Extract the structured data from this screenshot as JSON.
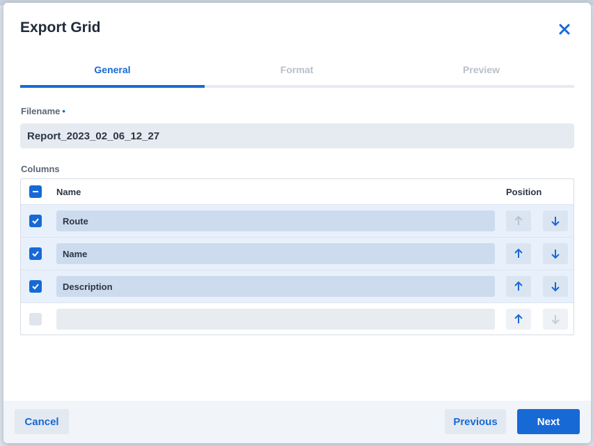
{
  "dialog": {
    "title": "Export Grid",
    "close_icon": "close-icon",
    "accent_color": "#1769d6"
  },
  "tabs": [
    {
      "label": "General",
      "active": true
    },
    {
      "label": "Format",
      "active": false
    },
    {
      "label": "Preview",
      "active": false
    }
  ],
  "filename": {
    "label": "Filename",
    "required_marker": "•",
    "value": "Report_2023_02_06_12_27"
  },
  "columns": {
    "label": "Columns",
    "header": {
      "name": "Name",
      "position": "Position",
      "select_all_state": "indeterminate"
    },
    "rows": [
      {
        "name": "Route",
        "checked": true,
        "up_enabled": false,
        "down_enabled": true
      },
      {
        "name": "Name",
        "checked": true,
        "up_enabled": true,
        "down_enabled": true
      },
      {
        "name": "Description",
        "checked": true,
        "up_enabled": true,
        "down_enabled": true
      },
      {
        "name": "",
        "checked": false,
        "up_enabled": true,
        "down_enabled": false
      }
    ]
  },
  "footer": {
    "cancel_label": "Cancel",
    "previous_label": "Previous",
    "next_label": "Next"
  }
}
